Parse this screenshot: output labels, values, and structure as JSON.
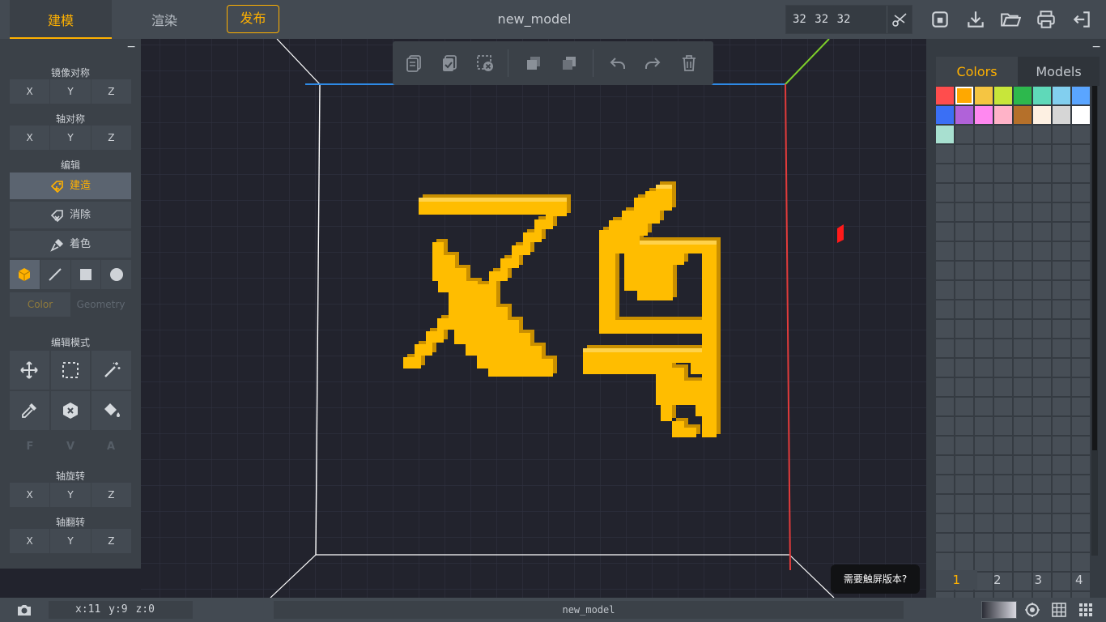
{
  "topbar": {
    "tabs": [
      {
        "label": "建模",
        "active": true
      },
      {
        "label": "渲染",
        "active": false
      }
    ],
    "publish_label": "发布",
    "model_title": "new_model",
    "grid_size": "32 32 32",
    "icons": [
      "scissors-icon",
      "save-icon",
      "download-icon",
      "open-folder-icon",
      "print-icon",
      "exit-icon"
    ]
  },
  "left_panel": {
    "collapse": "−",
    "mirror": {
      "label": "镜像对称",
      "axes": [
        "X",
        "Y",
        "Z"
      ]
    },
    "axis_symmetry": {
      "label": "轴对称",
      "axes": [
        "X",
        "Y",
        "Z"
      ]
    },
    "edit": {
      "label": "编辑",
      "actions": [
        {
          "label": "建造",
          "icon": "build-icon",
          "active": true
        },
        {
          "label": "消除",
          "icon": "erase-icon",
          "active": false
        },
        {
          "label": "着色",
          "icon": "paint-icon",
          "active": false
        }
      ],
      "shapes": [
        "cube-icon",
        "line-icon",
        "square-icon",
        "circle-icon"
      ],
      "subtabs": [
        {
          "label": "Color",
          "active": true
        },
        {
          "label": "Geometry",
          "active": false
        }
      ]
    },
    "edit_mode": {
      "label": "编辑模式",
      "tools": [
        "move-icon",
        "select-box-icon",
        "magic-wand-icon",
        "eyedropper-icon",
        "hex-erase-icon",
        "fill-bucket-icon"
      ],
      "fva": [
        "F",
        "V",
        "A"
      ]
    },
    "rotate": {
      "label": "轴旋转",
      "axes": [
        "X",
        "Y",
        "Z"
      ]
    },
    "flip": {
      "label": "轴翻转",
      "axes": [
        "X",
        "Y",
        "Z"
      ]
    }
  },
  "viewport_toolbar": {
    "icons": [
      "copy-icon",
      "paste-icon",
      "clear-selection-icon",
      "merge-icon",
      "split-icon",
      "undo-icon",
      "redo-icon",
      "delete-icon"
    ]
  },
  "viewport": {
    "voxel_color": "#ffbd00",
    "axis_x_color": "#e23b3b",
    "axis_y_color": "#7ecf2a",
    "axis_z_color": "#2e8ae6"
  },
  "right_panel": {
    "tabs": [
      {
        "label": "Colors",
        "active": true
      },
      {
        "label": "Models",
        "active": false
      }
    ],
    "palette": [
      "#ff4d4d",
      "#ffa800",
      "#f5c542",
      "#c8e63a",
      "#2db84d",
      "#5fd9b9",
      "#82cfef",
      "#5aa5ff",
      "#3a6ff5",
      "#b062d9",
      "#ff88f0",
      "#ffb3c8",
      "#b5702a",
      "#fdf0e2",
      "#d6d6d6",
      "#ffffff",
      "#a8e0d0"
    ],
    "selected_index": 1,
    "empty_slots": 199,
    "pages": [
      "1",
      "2",
      "3",
      "4"
    ],
    "active_page": 0
  },
  "touch_prompt": "需要触屏版本?",
  "statusbar": {
    "coords": "x:11 y:9 z:0",
    "model_name": "new_model",
    "icons": [
      "camera-icon",
      "target-icon",
      "grid-icon",
      "grid-dense-icon"
    ]
  }
}
